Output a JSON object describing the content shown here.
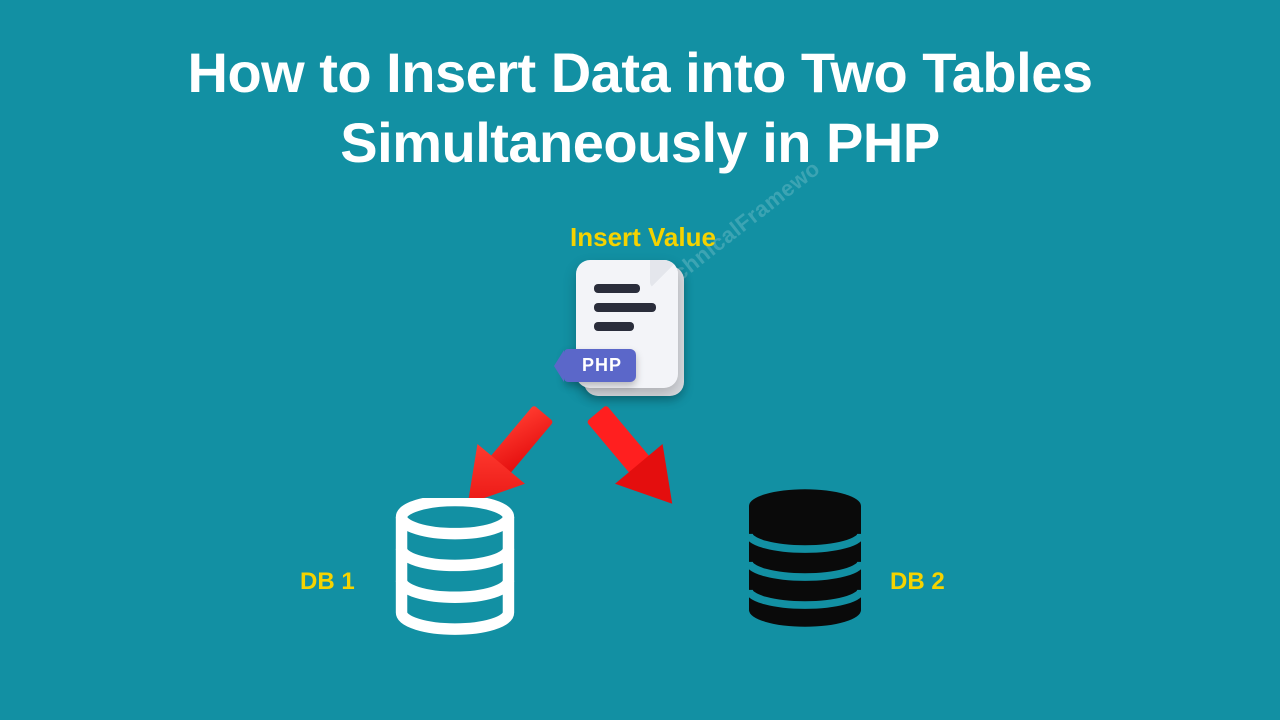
{
  "title_line1": "How to Insert Data into Two Tables",
  "title_line2": "Simultaneously in PHP",
  "insert_label": "Insert Value",
  "php_tag": "PHP",
  "db1_label": "DB 1",
  "db2_label": "DB 2",
  "watermark": "@PHPTechnicalFramewo",
  "colors": {
    "background": "#1290a3",
    "accent": "#f5d300",
    "arrow": "#ff1f1f",
    "db_left_stroke": "#ffffff",
    "db_right_fill": "#0a0a0a",
    "php_tag": "#5b67c9"
  }
}
